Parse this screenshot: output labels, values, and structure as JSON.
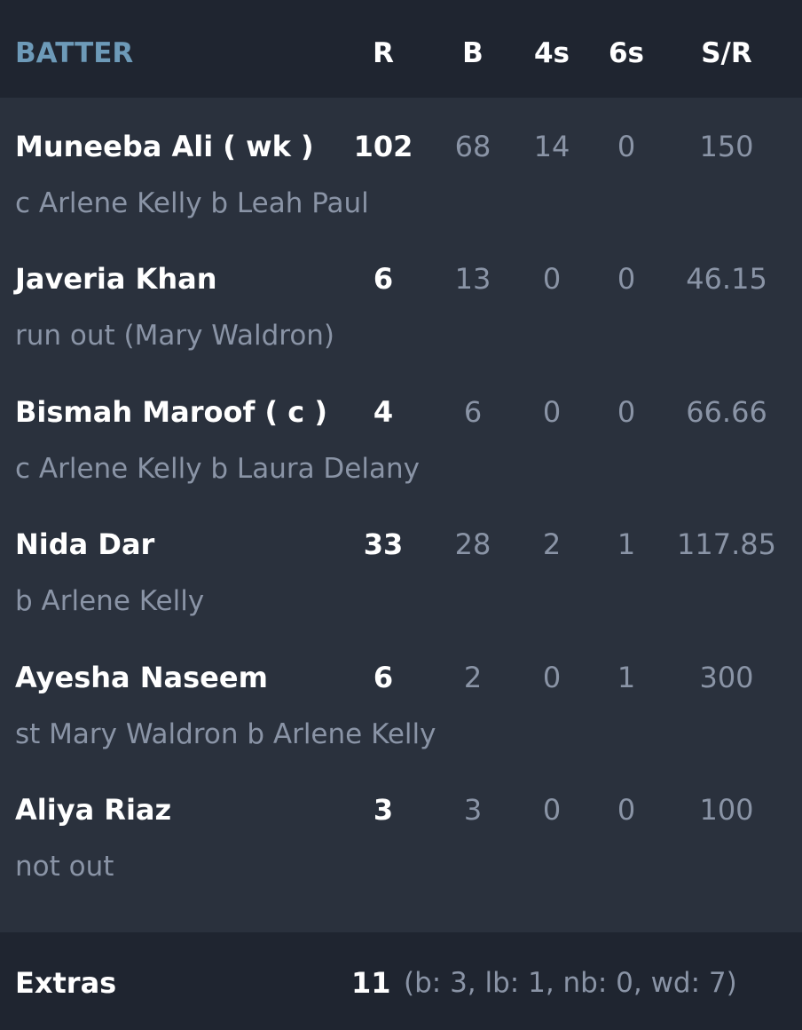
{
  "colors": {
    "background": "#2a313d",
    "header_background": "#1f2530",
    "accent": "#6d9ab8",
    "primary_text": "#ffffff",
    "muted_text": "#8a94a6"
  },
  "header": {
    "batter": "BATTER",
    "r": "R",
    "b": "B",
    "fours": "4s",
    "sixes": "6s",
    "sr": "S/R"
  },
  "batters": [
    {
      "name": "Muneeba Ali ( wk )",
      "dismissal": "c Arlene Kelly b Leah Paul",
      "r": "102",
      "b": "68",
      "fours": "14",
      "sixes": "0",
      "sr": "150"
    },
    {
      "name": "Javeria Khan",
      "dismissal": "run out (Mary Waldron)",
      "r": "6",
      "b": "13",
      "fours": "0",
      "sixes": "0",
      "sr": "46.15"
    },
    {
      "name": "Bismah Maroof ( c )",
      "dismissal": "c Arlene Kelly b Laura Delany",
      "r": "4",
      "b": "6",
      "fours": "0",
      "sixes": "0",
      "sr": "66.66"
    },
    {
      "name": "Nida Dar",
      "dismissal": "b Arlene Kelly",
      "r": "33",
      "b": "28",
      "fours": "2",
      "sixes": "1",
      "sr": "117.85"
    },
    {
      "name": "Ayesha Naseem",
      "dismissal": "st Mary Waldron b Arlene Kelly",
      "r": "6",
      "b": "2",
      "fours": "0",
      "sixes": "1",
      "sr": "300"
    },
    {
      "name": "Aliya Riaz",
      "dismissal": "not out",
      "r": "3",
      "b": "3",
      "fours": "0",
      "sixes": "0",
      "sr": "100"
    }
  ],
  "extras": {
    "label": "Extras",
    "total": "11",
    "detail": "(b: 3, lb: 1, nb: 0, wd: 7)"
  }
}
